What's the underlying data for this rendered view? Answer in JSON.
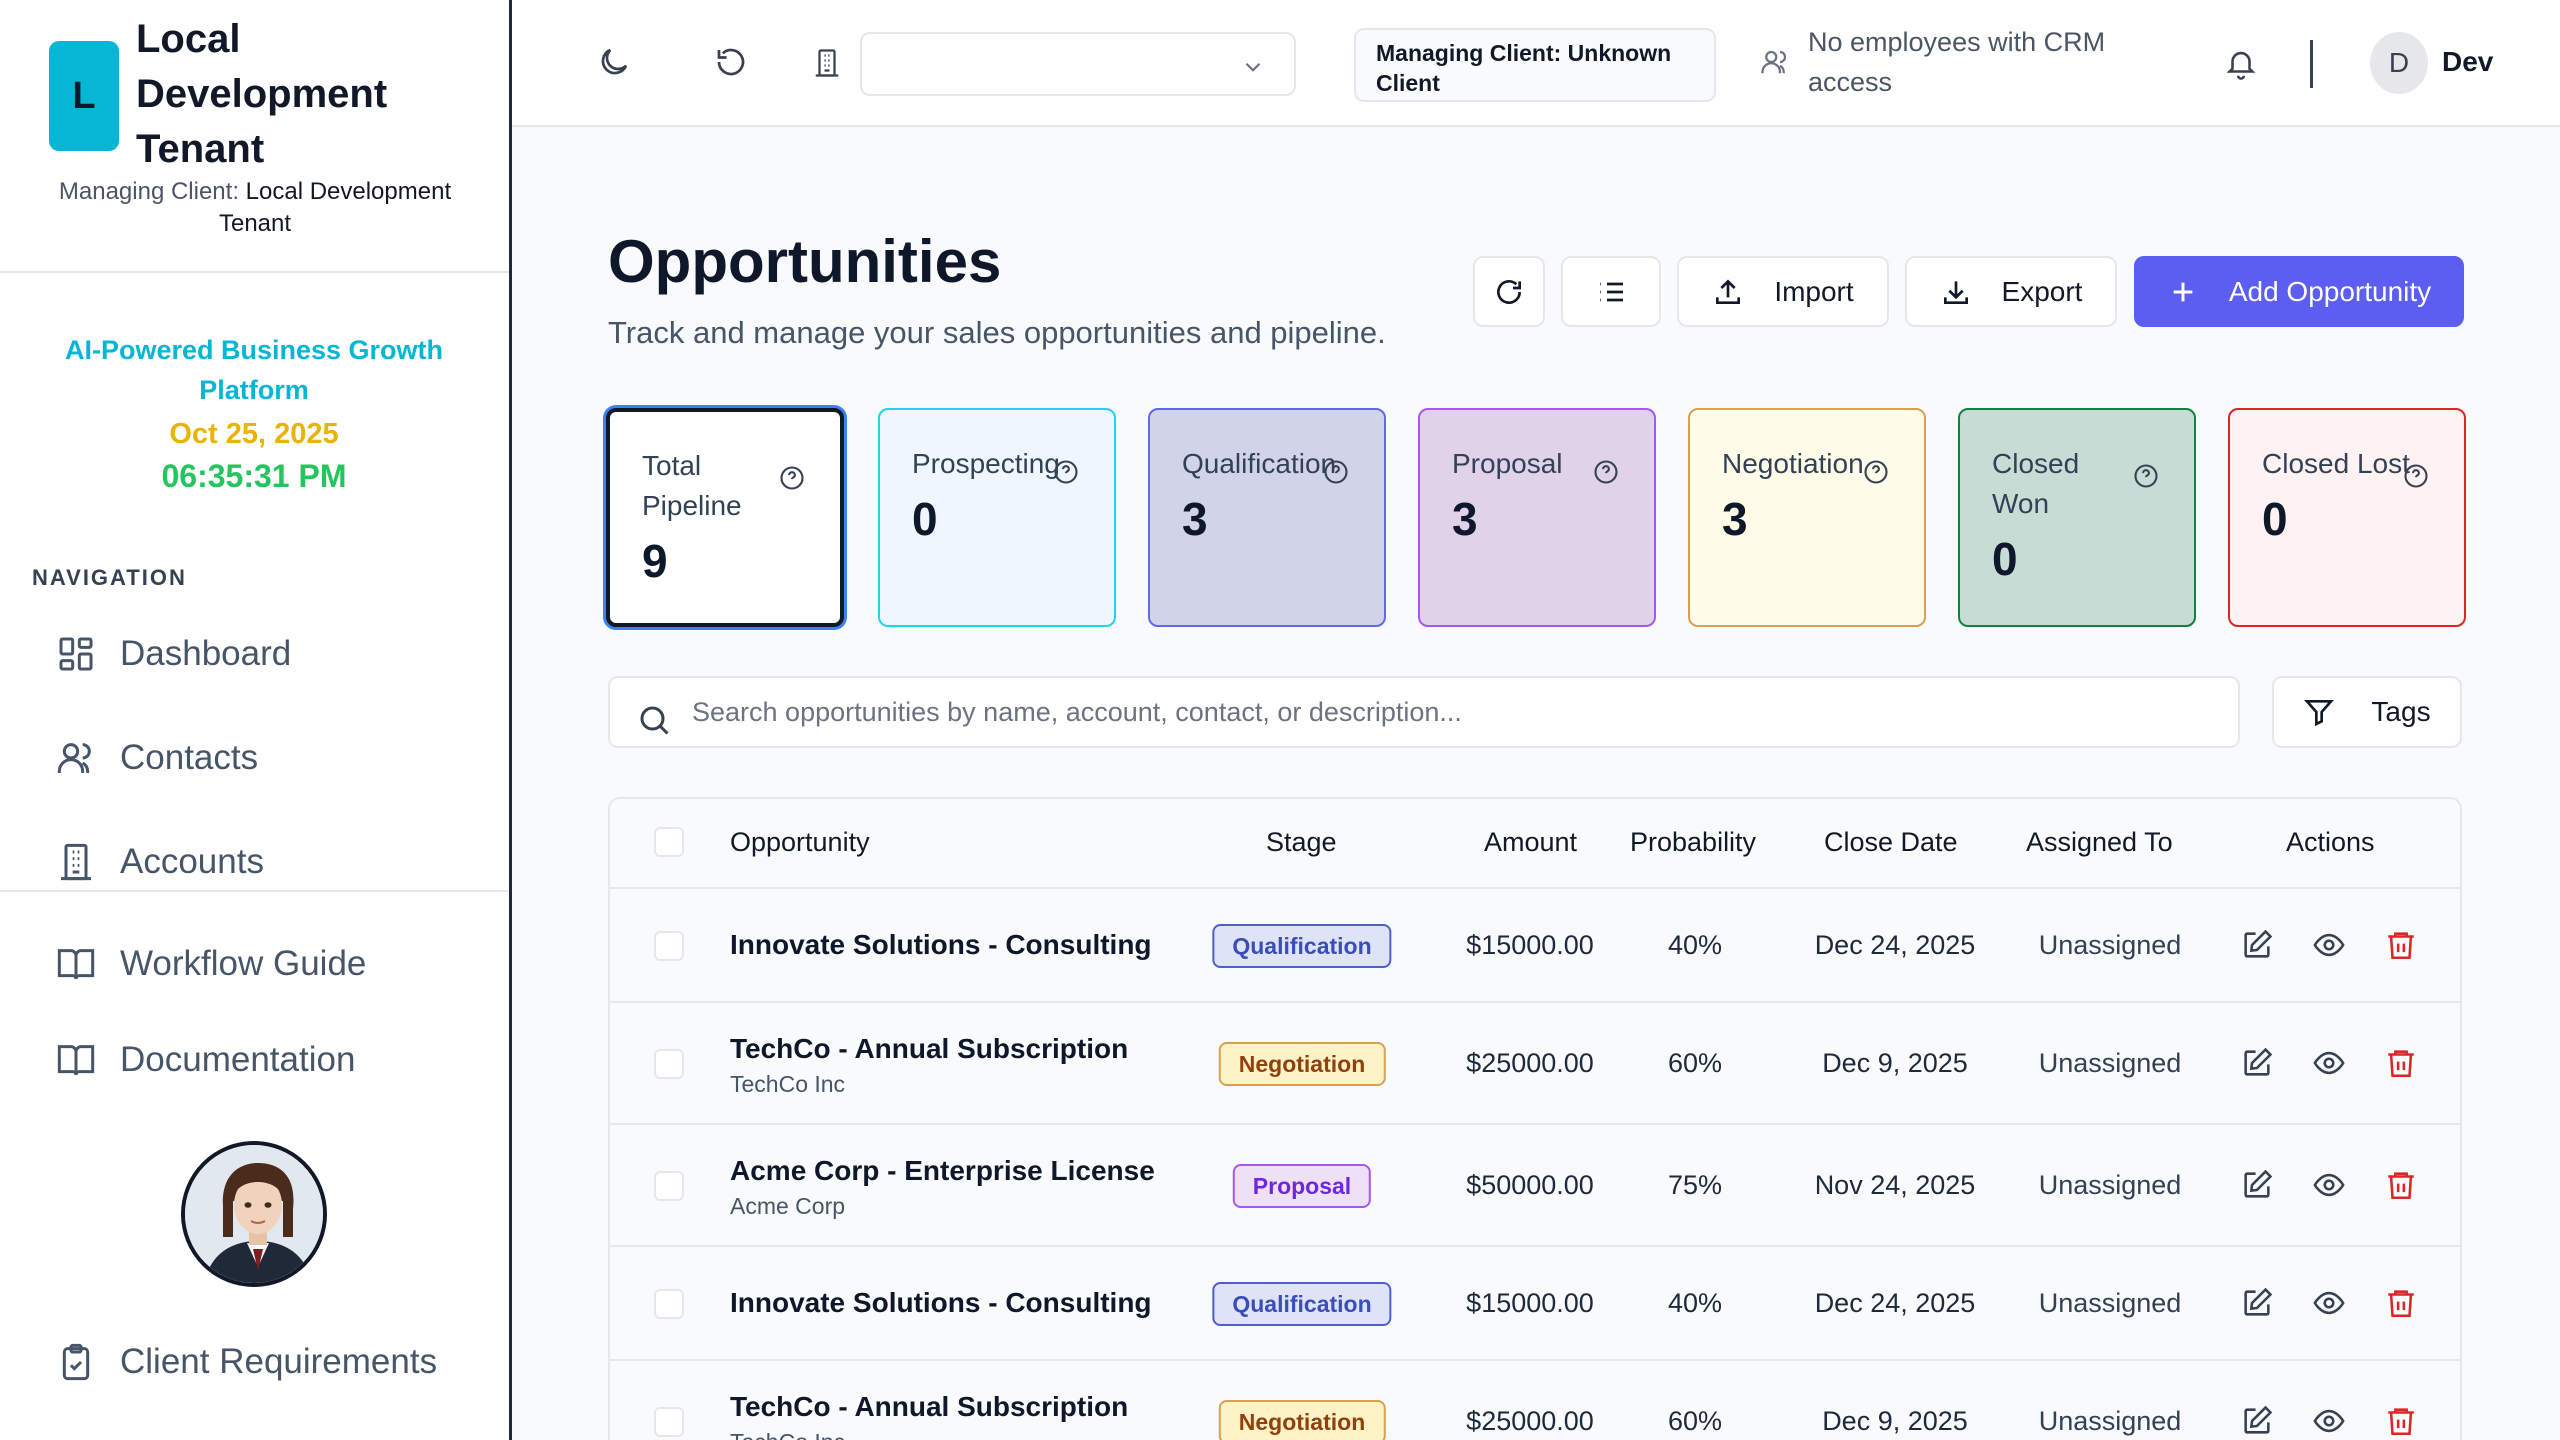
{
  "brand": {
    "logo_letter": "L",
    "name": "Local Development Tenant",
    "managing_label": "Managing Client:",
    "managing_value": "Local Development Tenant"
  },
  "promo": {
    "title": "AI-Powered Business Growth Platform",
    "date": "Oct 25, 2025",
    "time": "06:35:31 PM"
  },
  "nav": {
    "heading": "NAVIGATION",
    "dashboard": "Dashboard",
    "contacts": "Contacts",
    "accounts": "Accounts",
    "workflow_guide": "Workflow Guide",
    "documentation": "Documentation",
    "client_requirements": "Client Requirements"
  },
  "topbar": {
    "client_select_value": "",
    "managing_client": "Managing Client: Unknown Client",
    "crm_note": "No employees with CRM access",
    "user_initial": "D",
    "user_name": "Dev"
  },
  "page": {
    "title": "Opportunities",
    "subtitle": "Track and manage your sales opportunities and pipeline.",
    "import_label": "Import",
    "export_label": "Export",
    "add_label": "Add Opportunity",
    "search_placeholder": "Search opportunities by name, account, contact, or description...",
    "tags_label": "Tags"
  },
  "stats": [
    {
      "label": "Total Pipeline",
      "value": "9"
    },
    {
      "label": "Prospecting",
      "value": "0"
    },
    {
      "label": "Qualification",
      "value": "3"
    },
    {
      "label": "Proposal",
      "value": "3"
    },
    {
      "label": "Negotiation",
      "value": "3"
    },
    {
      "label": "Closed Won",
      "value": "0"
    },
    {
      "label": "Closed Lost",
      "value": "0"
    }
  ],
  "table": {
    "headers": {
      "opportunity": "Opportunity",
      "stage": "Stage",
      "amount": "Amount",
      "probability": "Probability",
      "close_date": "Close Date",
      "assigned_to": "Assigned To",
      "actions": "Actions"
    },
    "rows": [
      {
        "name": "Innovate Solutions - Consulting",
        "account": "",
        "stage": "Qualification",
        "amount": "$15000.00",
        "probability": "40%",
        "close_date": "Dec 24, 2025",
        "assigned": "Unassigned"
      },
      {
        "name": "TechCo - Annual Subscription",
        "account": "TechCo Inc",
        "stage": "Negotiation",
        "amount": "$25000.00",
        "probability": "60%",
        "close_date": "Dec 9, 2025",
        "assigned": "Unassigned"
      },
      {
        "name": "Acme Corp - Enterprise License",
        "account": "Acme Corp",
        "stage": "Proposal",
        "amount": "$50000.00",
        "probability": "75%",
        "close_date": "Nov 24, 2025",
        "assigned": "Unassigned"
      },
      {
        "name": "Innovate Solutions - Consulting",
        "account": "",
        "stage": "Qualification",
        "amount": "$15000.00",
        "probability": "40%",
        "close_date": "Dec 24, 2025",
        "assigned": "Unassigned"
      },
      {
        "name": "TechCo - Annual Subscription",
        "account": "TechCo Inc",
        "stage": "Negotiation",
        "amount": "$25000.00",
        "probability": "60%",
        "close_date": "Dec 9, 2025",
        "assigned": "Unassigned"
      }
    ]
  },
  "colors": {
    "brand": "#06b6d4",
    "primary": "#5b5ef0",
    "qualification": "#3b4db8",
    "negotiation": "#92400e",
    "proposal": "#6d28d9",
    "delete": "#dc2626"
  },
  "icons": [
    "moon-icon",
    "refresh-icon",
    "building-icon",
    "chevron-down-icon",
    "users-icon",
    "bell-icon",
    "grid-icon",
    "book-icon",
    "clipboard-icon",
    "upload-icon",
    "download-icon",
    "plus-icon",
    "list-icon",
    "search-icon",
    "filter-icon",
    "help-icon",
    "edit-icon",
    "eye-icon",
    "trash-icon"
  ]
}
